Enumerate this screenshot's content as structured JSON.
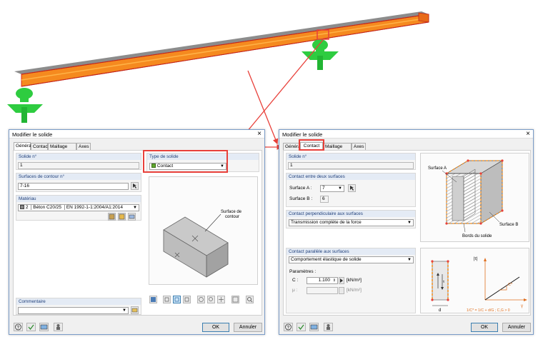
{
  "colors": {
    "accent_red": "#e8403a",
    "support_green": "#2ecc40",
    "beam_orange": "#f08c1e",
    "contact_green": "#5fa82c"
  },
  "left_dialog": {
    "title": "Modifier le solide",
    "tabs": [
      "Général",
      "Contact",
      "Maillage EF",
      "Axes"
    ],
    "solide_label": "Solide n°",
    "solide_value": "1",
    "surfaces_label": "Surfaces de contour n°",
    "surfaces_value": "7-16",
    "materiau_label": "Matériau",
    "materiau_num": "2",
    "materiau_name": "Béton C20/25",
    "materiau_norm": "EN 1992-1-1:2004/A1:2014",
    "type_label": "Type de solide",
    "type_value": "Contact",
    "commentaire_label": "Commentaire",
    "preview_label_1": "Surface de",
    "preview_label_2": "contour",
    "ok": "OK",
    "cancel": "Annuler"
  },
  "right_dialog": {
    "title": "Modifier le solide",
    "tabs": [
      "Général",
      "Contact",
      "Maillage EF",
      "Axes"
    ],
    "solide_label": "Solide n°",
    "solide_value": "1",
    "contact_between_label": "Contact entre deux surfaces",
    "surface_a_label": "Surface A :",
    "surface_a_value": "7",
    "surface_b_label": "Surface B :",
    "surface_b_value": "6",
    "perp_label": "Contact perpendiculaire aux surfaces",
    "perp_value": "Transmission complète de la force",
    "parallel_label": "Contact parallèle aux surfaces",
    "parallel_value": "Comportement élastique de solide",
    "params_label": "Paramètres :",
    "c_label": "C :",
    "c_value": "1.100",
    "c_unit": "[kN/m³]",
    "mu_label": "μ :",
    "mu_unit": "[kN/m²]",
    "diagram_surface_a": "Surface A",
    "diagram_surface_b": "Surface B",
    "diagram_edges": "Bords du solide",
    "diagram_tau": "|τ|",
    "diagram_cstar": "C*",
    "diagram_gamma": "γ",
    "diagram_formula": "1/C* = 1/C + d/G ; C,G > 0",
    "diagram_d": "d",
    "ok": "OK",
    "cancel": "Annuler"
  }
}
